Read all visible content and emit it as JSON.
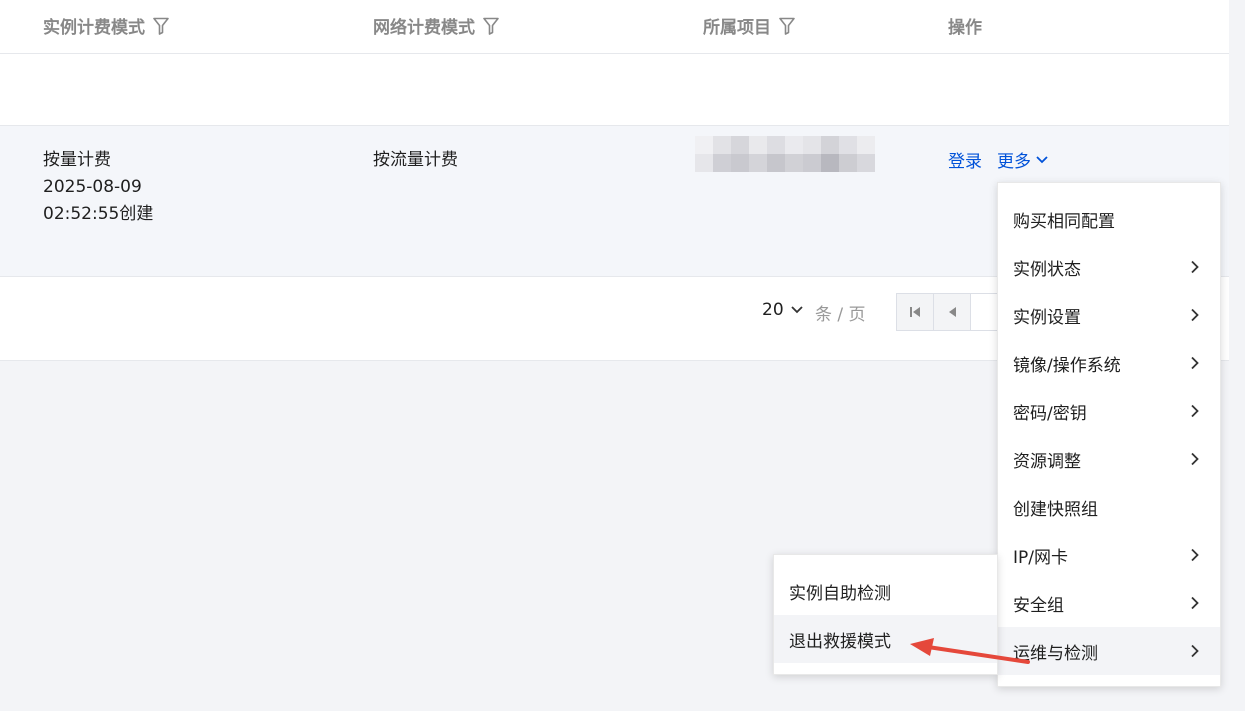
{
  "table": {
    "columns": [
      {
        "label": "实例计费模式",
        "filterable": true
      },
      {
        "label": "网络计费模式",
        "filterable": true
      },
      {
        "label": "所属项目",
        "filterable": true
      },
      {
        "label": "操作",
        "filterable": false
      }
    ],
    "row": {
      "billing_mode": "按量计费",
      "created_date": "2025-08-09",
      "created_time": "02:52:55创建",
      "network_billing": "按流量计费",
      "project": "",
      "action_login": "登录",
      "action_more": "更多"
    }
  },
  "pagination": {
    "page_size": "20",
    "per_page_label": "条 / 页"
  },
  "more_menu": {
    "items": [
      {
        "label": "购买相同配置",
        "has_submenu": false
      },
      {
        "label": "实例状态",
        "has_submenu": true
      },
      {
        "label": "实例设置",
        "has_submenu": true
      },
      {
        "label": "镜像/操作系统",
        "has_submenu": true
      },
      {
        "label": "密码/密钥",
        "has_submenu": true
      },
      {
        "label": "资源调整",
        "has_submenu": true
      },
      {
        "label": "创建快照组",
        "has_submenu": false
      },
      {
        "label": "IP/网卡",
        "has_submenu": true
      },
      {
        "label": "安全组",
        "has_submenu": true
      },
      {
        "label": "运维与检测",
        "has_submenu": true,
        "active": true
      }
    ]
  },
  "submenu": {
    "items": [
      {
        "label": "实例自助检测"
      },
      {
        "label": "退出救援模式",
        "active": true
      }
    ]
  },
  "colors": {
    "link": "#0052d9",
    "header_text": "#888888",
    "row_bg": "#f4f6fa",
    "annotation_arrow": "#e5483b"
  }
}
